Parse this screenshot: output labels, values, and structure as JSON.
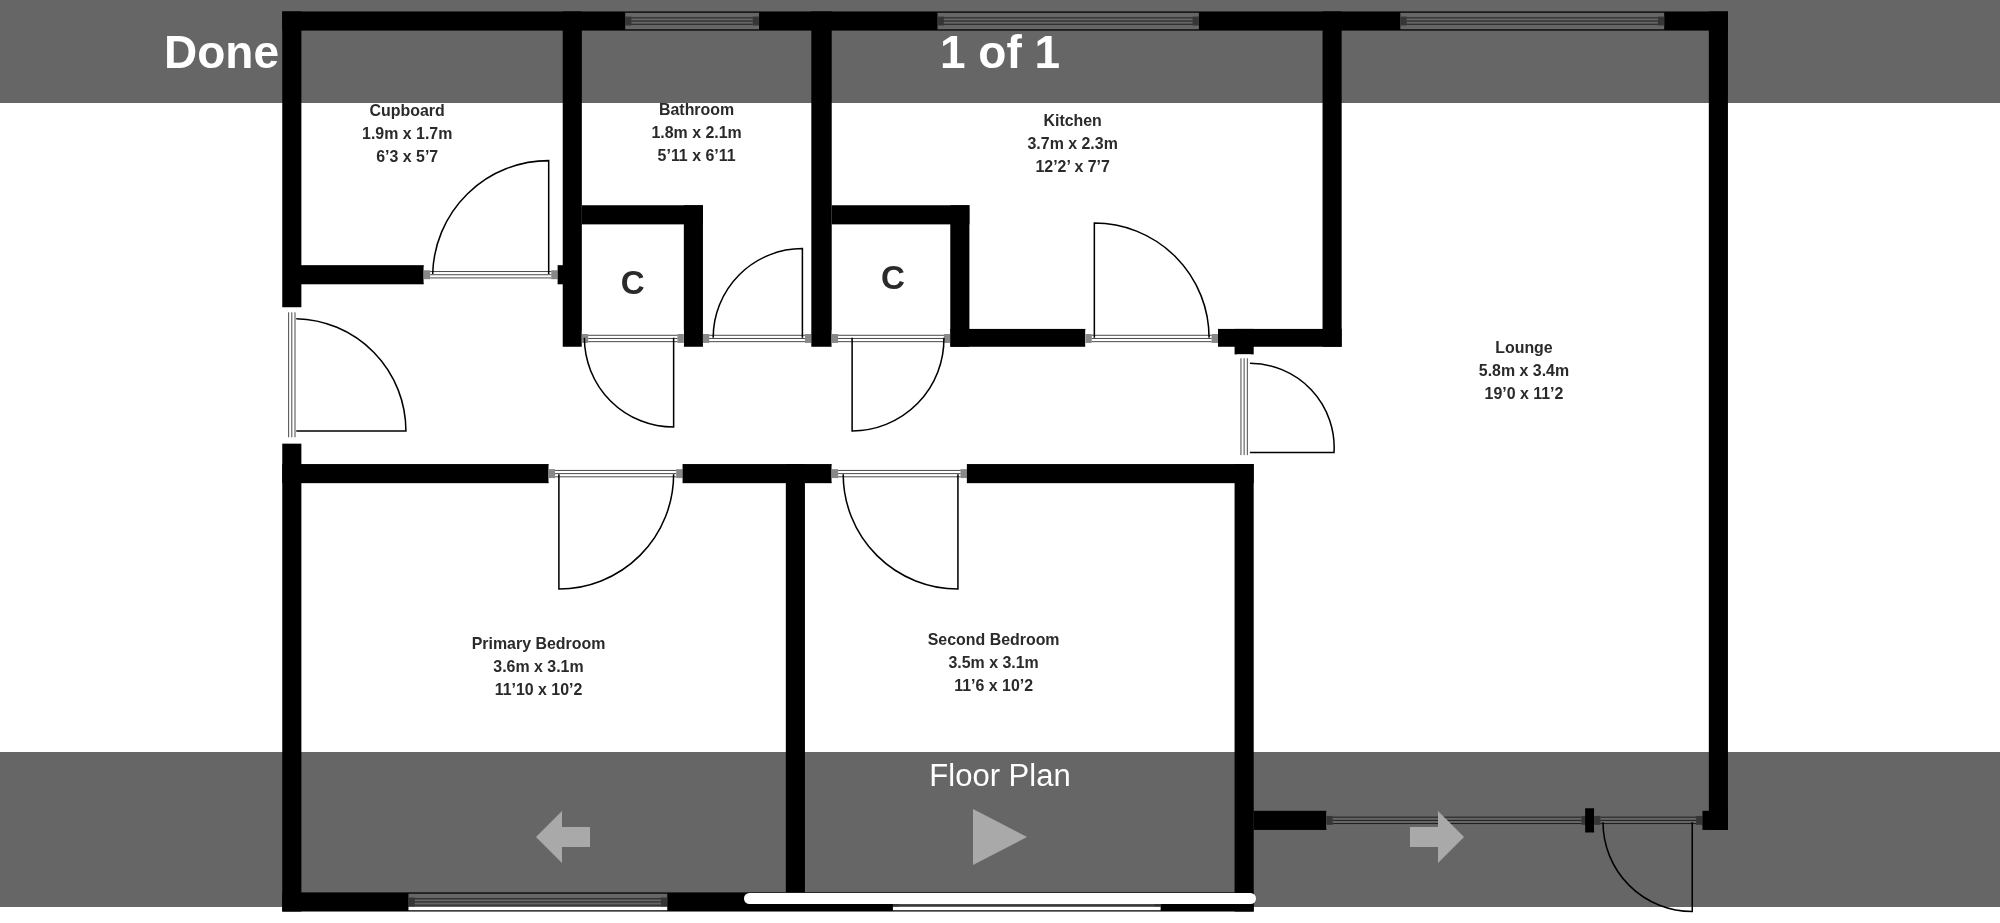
{
  "top_bar": {
    "done": "Done",
    "counter": "1 of 1"
  },
  "floor_plan": {
    "rooms": [
      {
        "name": "Cupboard",
        "metric": "1.9m x 1.7m",
        "imperial": "6’3 x 5’7"
      },
      {
        "name": "Bathroom",
        "metric": "1.8m x 2.1m",
        "imperial": "5’11 x 6’11"
      },
      {
        "name": "Kitchen",
        "metric": "3.7m x 2.3m",
        "imperial": "12’2’ x 7’7"
      },
      {
        "name": "Lounge",
        "metric": "5.8m x 3.4m",
        "imperial": "19’0 x 11’2"
      },
      {
        "name": "Primary Bedroom",
        "metric": "3.6m x 3.1m",
        "imperial": "11’10 x 10’2"
      },
      {
        "name": "Second Bedroom",
        "metric": "3.5m x 3.1m",
        "imperial": "11’6 x 10’2"
      }
    ],
    "closets": [
      "C",
      "C"
    ]
  },
  "bottom_bar": {
    "caption": "Floor Plan"
  }
}
